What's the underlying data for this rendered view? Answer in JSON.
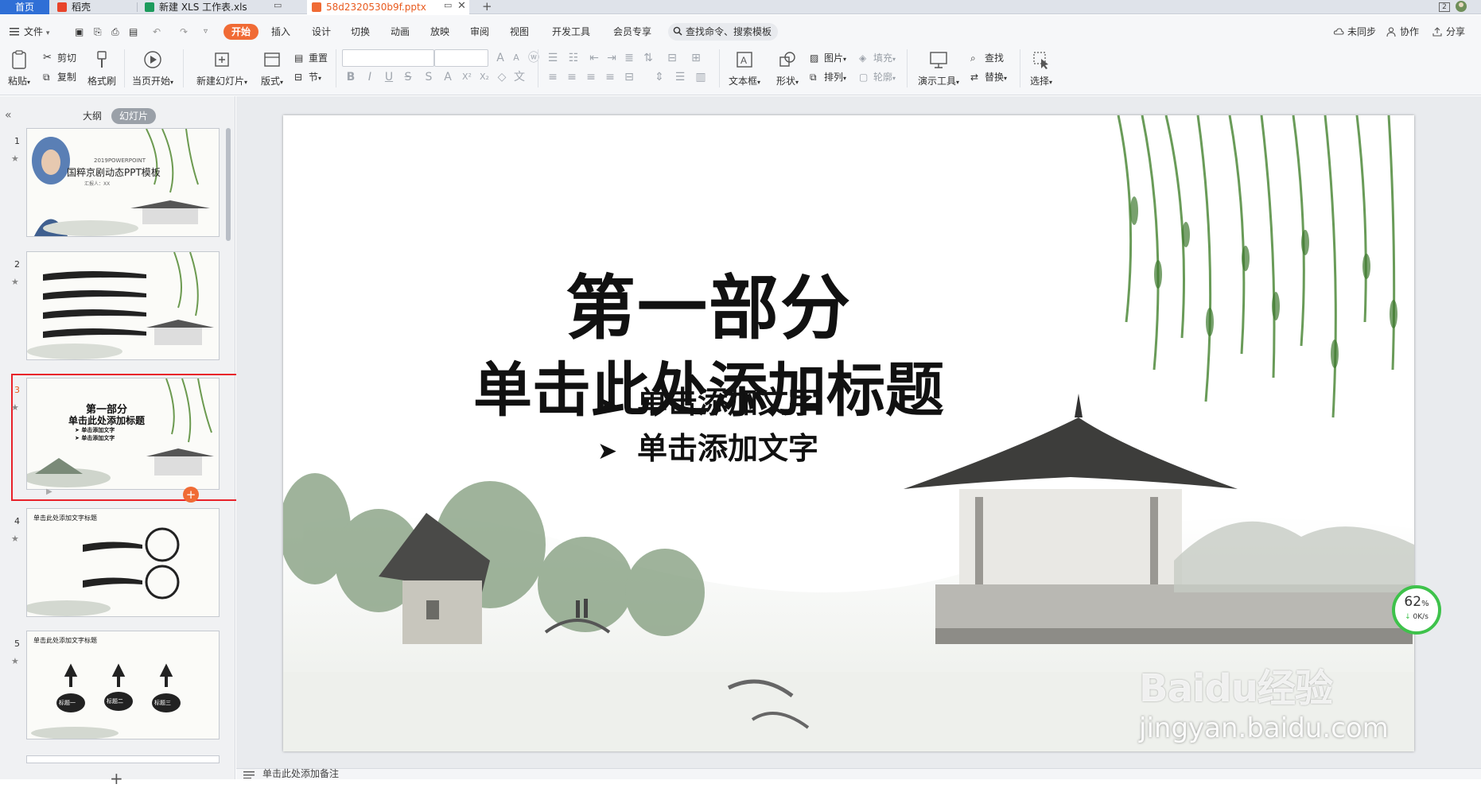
{
  "tabs": {
    "home": "首页",
    "items": [
      {
        "label": "稻壳",
        "color": "#e8442a"
      },
      {
        "label": "新建 XLS 工作表.xls",
        "color": "#1d9b5c"
      },
      {
        "label": "58d2320530b9f.pptx",
        "color": "#f06b35"
      }
    ],
    "new_tab": "+",
    "badge": "2"
  },
  "menu": {
    "file": "文件",
    "items": [
      "开始",
      "插入",
      "设计",
      "切换",
      "动画",
      "放映",
      "审阅",
      "视图",
      "开发工具",
      "会员专享"
    ],
    "active": "开始",
    "search": "查找命令、搜索模板",
    "right": [
      "未同步",
      "协作",
      "分享"
    ]
  },
  "ribbon": {
    "paste": "粘贴",
    "cut": "剪切",
    "copy": "复制",
    "format_painter": "格式刷",
    "play_from_current": "当页开始",
    "new_slide": "新建幻灯片",
    "layout": "版式",
    "reset": "重置",
    "section": "节",
    "textbox": "文本框",
    "shape": "形状",
    "picture": "图片",
    "fill": "填充",
    "arrange": "排列",
    "outline": "轮廓",
    "presenter_tools": "演示工具",
    "find": "查找",
    "replace": "替换",
    "select": "选择"
  },
  "left_panel": {
    "tab_outline": "大纲",
    "tab_slides": "幻灯片",
    "slides": [
      {
        "num": "1",
        "subtitle": "2019POWERPOINT",
        "title": "国粹京剧动态PPT模板",
        "reporter": "汇报人：XX"
      },
      {
        "num": "2"
      },
      {
        "num": "3",
        "title1": "第一部分",
        "title2": "单击此处添加标题",
        "b1": "单击添加文字",
        "b2": "单击添加文字"
      },
      {
        "num": "4",
        "title": "单击此处添加文字标题"
      },
      {
        "num": "5",
        "title": "单击此处添加文字标题",
        "labels": [
          "标题一",
          "标题二",
          "标题三"
        ]
      }
    ]
  },
  "slide": {
    "title1": "第一部分",
    "title2": "单击此处添加标题",
    "bullets": [
      "单击添加文字",
      "单击添加文字"
    ]
  },
  "notes": {
    "placeholder": "单击此处添加备注"
  },
  "speed": {
    "percent": "62",
    "percent_unit": "%",
    "rate": "0K/s"
  },
  "watermark": {
    "brand": "Baidu经验",
    "url": "jingyan.baidu.com"
  },
  "colors": {
    "accent": "#f06b35",
    "home_tab": "#2f6fd6",
    "selected_border": "#e8222a",
    "speed_ring": "#3ec24b"
  }
}
